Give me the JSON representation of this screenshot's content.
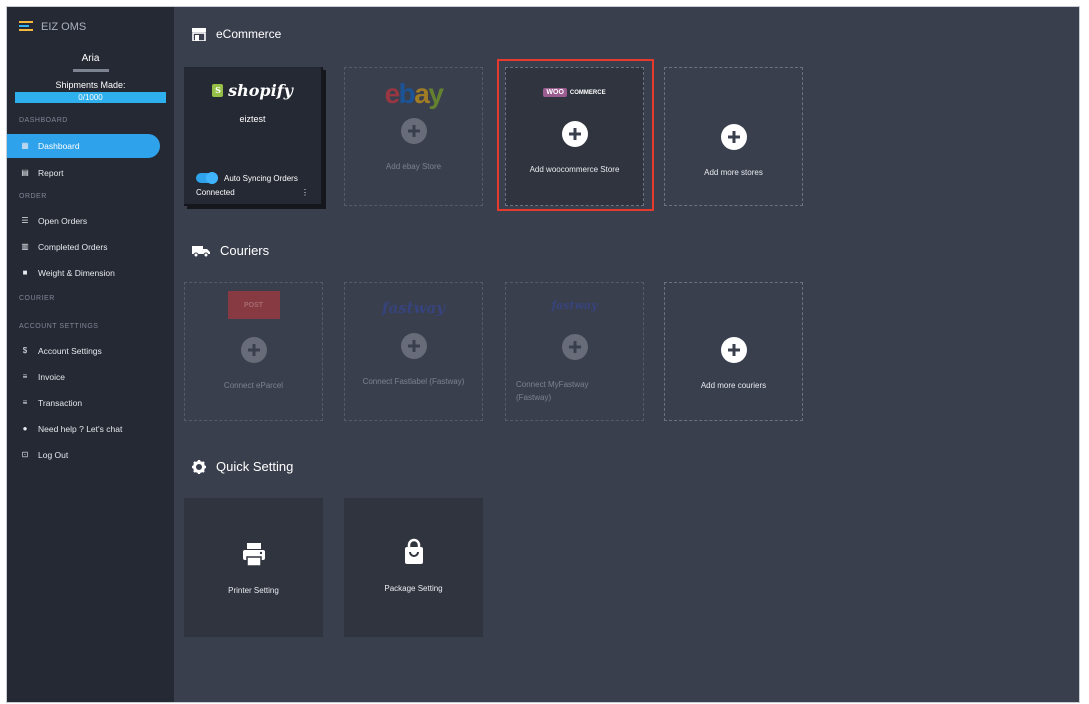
{
  "brand": {
    "name": "EIZ OMS"
  },
  "user": {
    "name": "Aria",
    "shipments_label": "Shipments Made:",
    "shipments_value": "0/1000"
  },
  "sidebar": {
    "sections": {
      "dashboard": "DASHBOARD",
      "order": "ORDER",
      "courier": "COURIER",
      "account": "ACCOUNT SETTINGS"
    },
    "items": {
      "dashboard": "Dashboard",
      "report": "Report",
      "open_orders": "Open Orders",
      "completed_orders": "Completed Orders",
      "weight_dimension": "Weight & Dimension",
      "account_settings": "Account Settings",
      "invoice": "Invoice",
      "transaction": "Transaction",
      "need_help": "Need help ? Let's chat",
      "log_out": "Log Out"
    },
    "active_item": "dashboard"
  },
  "ecommerce": {
    "title": "eCommerce",
    "shopify": {
      "logo_text": "shopify",
      "store_name": "eiztest",
      "sync_label": "Auto Syncing Orders",
      "sync_on": true,
      "status": "Connected",
      "menu_glyph": "⋮"
    },
    "ebay": {
      "logo_e": "e",
      "logo_b": "b",
      "logo_a": "a",
      "logo_y": "y",
      "caption": "Add ebay Store"
    },
    "woocommerce": {
      "logo_woo": "WOO",
      "logo_commerce": "COMMERCE",
      "caption": "Add woocommerce Store"
    },
    "more": {
      "caption": "Add more stores"
    }
  },
  "couriers": {
    "title": "Couriers",
    "eparcel": {
      "logo_text": "POST",
      "caption": "Connect eParcel"
    },
    "fastlabel": {
      "logo_text": "fastway",
      "caption": "Connect Fastlabel (Fastway)"
    },
    "myfastway": {
      "logo_text": "fastway",
      "caption_line1": "Connect MyFastway",
      "caption_line2": "(Fastway)"
    },
    "more": {
      "caption": "Add more couriers"
    }
  },
  "quick_setting": {
    "title": "Quick Setting",
    "printer": "Printer Setting",
    "package": "Package Setting"
  },
  "colors": {
    "accent": "#2fa2ec",
    "highlight": "#e63a2e",
    "background": "#3a3f4e",
    "sidebar": "#252933"
  }
}
